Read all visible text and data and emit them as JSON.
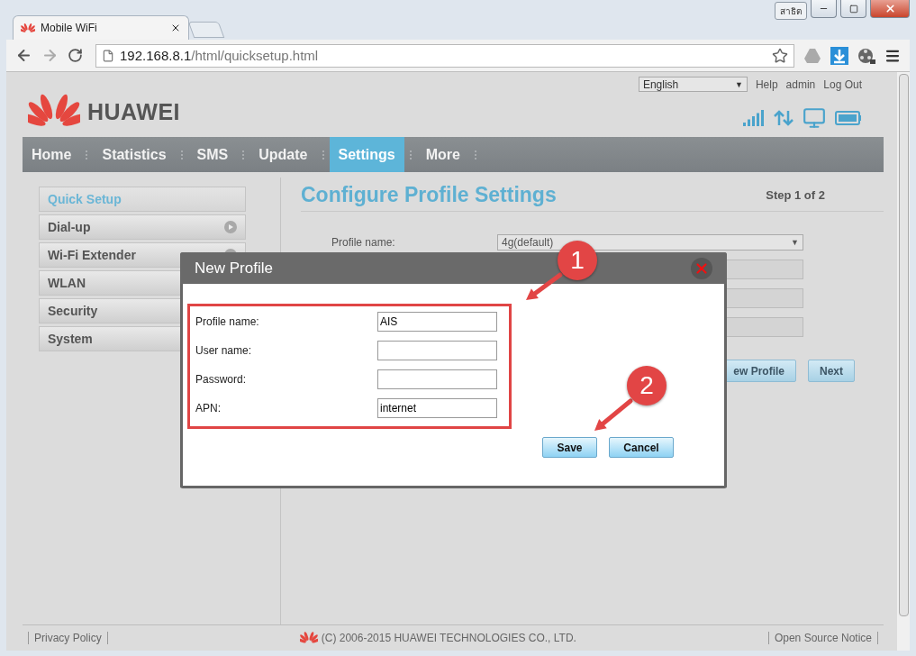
{
  "window": {
    "profile_badge": "สาธิต"
  },
  "tabs": [
    {
      "title": "Mobile WiFi",
      "selected": true
    }
  ],
  "address_bar": {
    "host": "192.168.8.1",
    "path": "/html/quicksetup.html"
  },
  "header": {
    "language": "English",
    "language_caret": "▼",
    "links": [
      "Help",
      "admin",
      "Log Out"
    ],
    "logo": "HUAWEI"
  },
  "nav": [
    {
      "label": "Home",
      "selected": false
    },
    {
      "label": "Statistics",
      "selected": false
    },
    {
      "label": "SMS",
      "selected": false
    },
    {
      "label": "Update",
      "selected": false
    },
    {
      "label": "Settings",
      "selected": true
    },
    {
      "label": "More",
      "selected": false
    }
  ],
  "sidebar": [
    {
      "label": "Quick Setup",
      "selected": true,
      "expandable": false
    },
    {
      "label": "Dial-up",
      "selected": false,
      "expandable": true
    },
    {
      "label": "Wi-Fi Extender",
      "selected": false,
      "expandable": true
    },
    {
      "label": "WLAN",
      "selected": false
    },
    {
      "label": "Security",
      "selected": false
    },
    {
      "label": "System",
      "selected": false
    }
  ],
  "main": {
    "title": "Configure Profile Settings",
    "step": "Step 1 of 2",
    "label": "Profile name:",
    "fields": [
      {
        "kind": "select",
        "value": "4g(default)",
        "caret": "▼"
      },
      {
        "kind": "disabled"
      },
      {
        "kind": "disabled"
      },
      {
        "kind": "disabled"
      }
    ],
    "buttons": [
      "ew Profile",
      "Next"
    ]
  },
  "dialog": {
    "title": "New Profile",
    "fields": [
      {
        "label": "Profile name:",
        "value": "AIS"
      },
      {
        "label": "User name:"
      },
      {
        "label": "Password:"
      },
      {
        "label": "APN:",
        "value": "internet"
      }
    ],
    "buttons": [
      "Save",
      "Cancel"
    ]
  },
  "annotations": [
    {
      "number": "1"
    },
    {
      "number": "2"
    }
  ],
  "footer": {
    "left": "Privacy Policy",
    "copyright": "(C) 2006-2015 HUAWEI TECHNOLOGIES CO., LTD.",
    "right": "Open Source Notice"
  }
}
